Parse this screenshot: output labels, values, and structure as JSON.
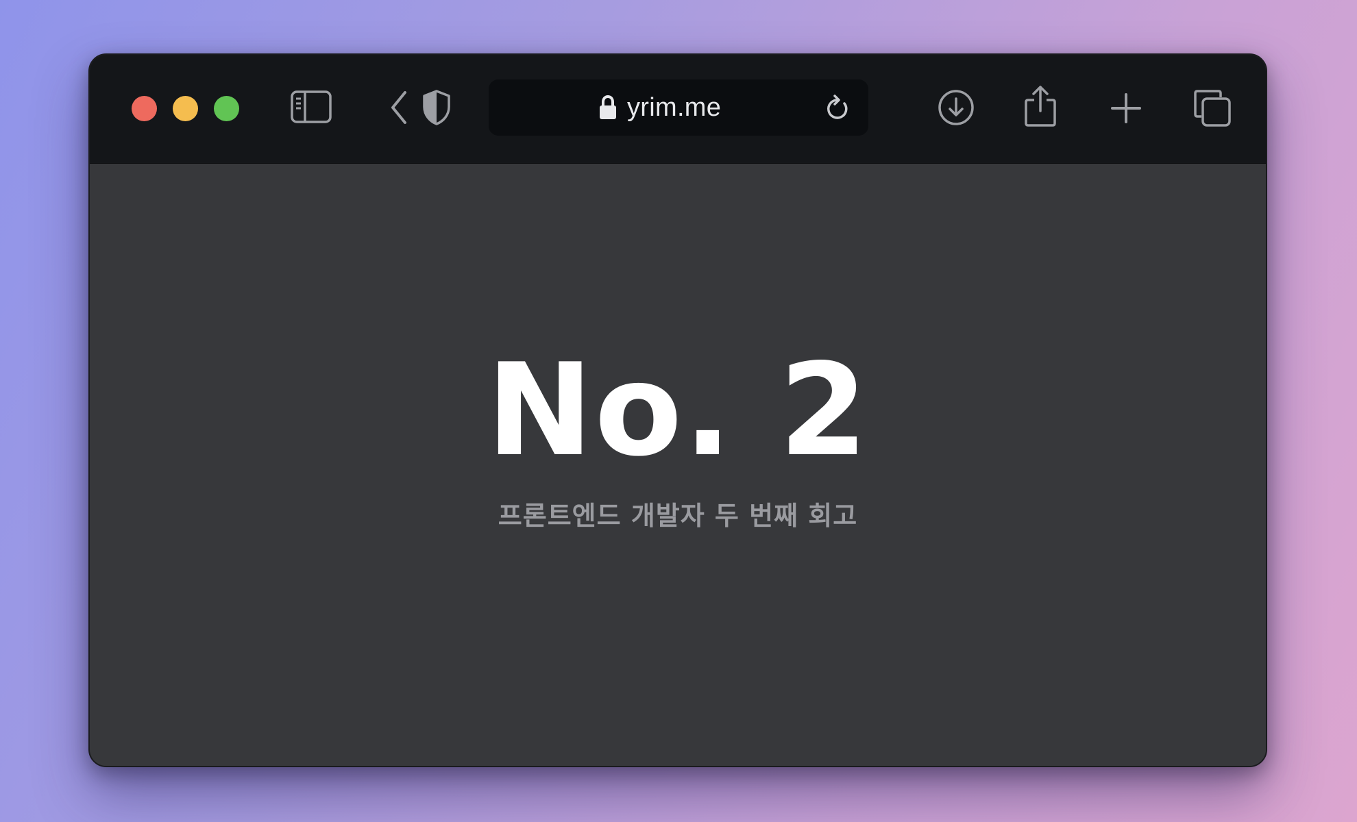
{
  "browser": {
    "address_bar": {
      "url": "yrim.me"
    },
    "icons": {
      "sidebar": "sidebar-icon",
      "back": "chevron-left-icon",
      "privacy": "shield-icon",
      "lock": "lock-icon",
      "reload": "reload-icon",
      "downloads": "download-icon",
      "share": "share-icon",
      "new_tab": "plus-icon",
      "tabs": "tab-overview-icon"
    },
    "colors": {
      "close": "#ee6a5e",
      "minimize": "#f5bd4f",
      "maximize": "#61c454",
      "toolbar": "#141619",
      "page_background": "#37383b"
    }
  },
  "page": {
    "title": "No. 2",
    "subtitle": "프론트엔드 개발자 두 번째 회고"
  }
}
